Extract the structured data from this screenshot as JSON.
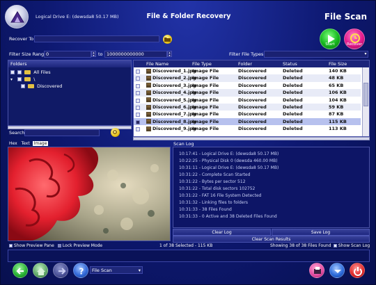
{
  "header": {
    "drive_info": "Logical Drive E: (dewsda8 50.17 MB)",
    "app_title": "File & Folder Recovery",
    "mode_title": "File Scan",
    "start_label": "Start",
    "recover_label": "Recover"
  },
  "recover_to": {
    "label": "Recover To",
    "value": ""
  },
  "filter": {
    "size_label": "Filter Size Range",
    "size_min": "0",
    "to_label": "to",
    "size_max": "1000000000000",
    "types_label": "Filter File Types",
    "types_value": ""
  },
  "folders": {
    "header": "Folders",
    "items": [
      {
        "label": "All Files"
      },
      {
        "label": "\\"
      },
      {
        "label": "Discovered"
      }
    ]
  },
  "table": {
    "columns": [
      "File Name",
      "File Type",
      "Folder",
      "Status",
      "File Size"
    ],
    "rows": [
      {
        "name": "Discovered_1.jpg",
        "type": "Image File",
        "folder": "Discovered",
        "status": "Deleted",
        "size": "140 KB"
      },
      {
        "name": "Discovered_2.jpg",
        "type": "Image File",
        "folder": "Discovered",
        "status": "Deleted",
        "size": "48 KB"
      },
      {
        "name": "Discovered_3.jpg",
        "type": "Image File",
        "folder": "Discovered",
        "status": "Deleted",
        "size": "65 KB"
      },
      {
        "name": "Discovered_4.jpg",
        "type": "Image File",
        "folder": "Discovered",
        "status": "Deleted",
        "size": "106 KB"
      },
      {
        "name": "Discovered_5.jpg",
        "type": "Image File",
        "folder": "Discovered",
        "status": "Deleted",
        "size": "104 KB"
      },
      {
        "name": "Discovered_6.jpg",
        "type": "Image File",
        "folder": "Discovered",
        "status": "Deleted",
        "size": "59 KB"
      },
      {
        "name": "Discovered_7.jpg",
        "type": "Image File",
        "folder": "Discovered",
        "status": "Deleted",
        "size": "87 KB"
      },
      {
        "name": "Discovered_8.jpg",
        "type": "Image File",
        "folder": "Discovered",
        "status": "Deleted",
        "size": "115 KB"
      },
      {
        "name": "Discovered_9.jpg",
        "type": "Image File",
        "folder": "Discovered",
        "status": "Deleted",
        "size": "113 KB"
      }
    ]
  },
  "search": {
    "label": "Search",
    "value": ""
  },
  "preview": {
    "tab_hex": "Hex",
    "tab_text": "Text",
    "tab_image": "Image",
    "show_preview": "Show Preview Pane",
    "lock_preview": "Lock Preview Mode"
  },
  "scan_log": {
    "header": "Scan Log",
    "lines": [
      "10:17:41 - Logical Drive E: (dewsda8 50.17 MB)",
      "10:22:25 - Physical Disk 0 (dewsda 460.00 MB)",
      "10:31:11 - Logical Drive E: (dewsda8 50.17 MB)",
      "10:31:22 - Complete Scan Started",
      "10:31:22 - Bytes per sector 512",
      "10:31:22 - Total disk sectors 102752",
      "10:31:22 - FAT 16 File System Detected",
      "10:31:32 - Linking files to folders",
      "10:31:33 - 38 Files Found",
      "10:31:33 - 0 Active and 38 Deleted Files Found"
    ],
    "clear_log": "Clear Log",
    "save_log": "Save Log",
    "clear_results": "Clear Scan Results",
    "show_scan_log": "Show Scan Log"
  },
  "status": {
    "selected": "1 of 38 Selected - 115 KB",
    "showing": "Showing 38 of 38 Files Found"
  },
  "bottom": {
    "mode_select": "File Scan"
  },
  "colors": {
    "background": "#0d1870",
    "accent_green": "#16b81e",
    "accent_pink": "#e4198c",
    "selected_row": "#b7c1ee"
  }
}
